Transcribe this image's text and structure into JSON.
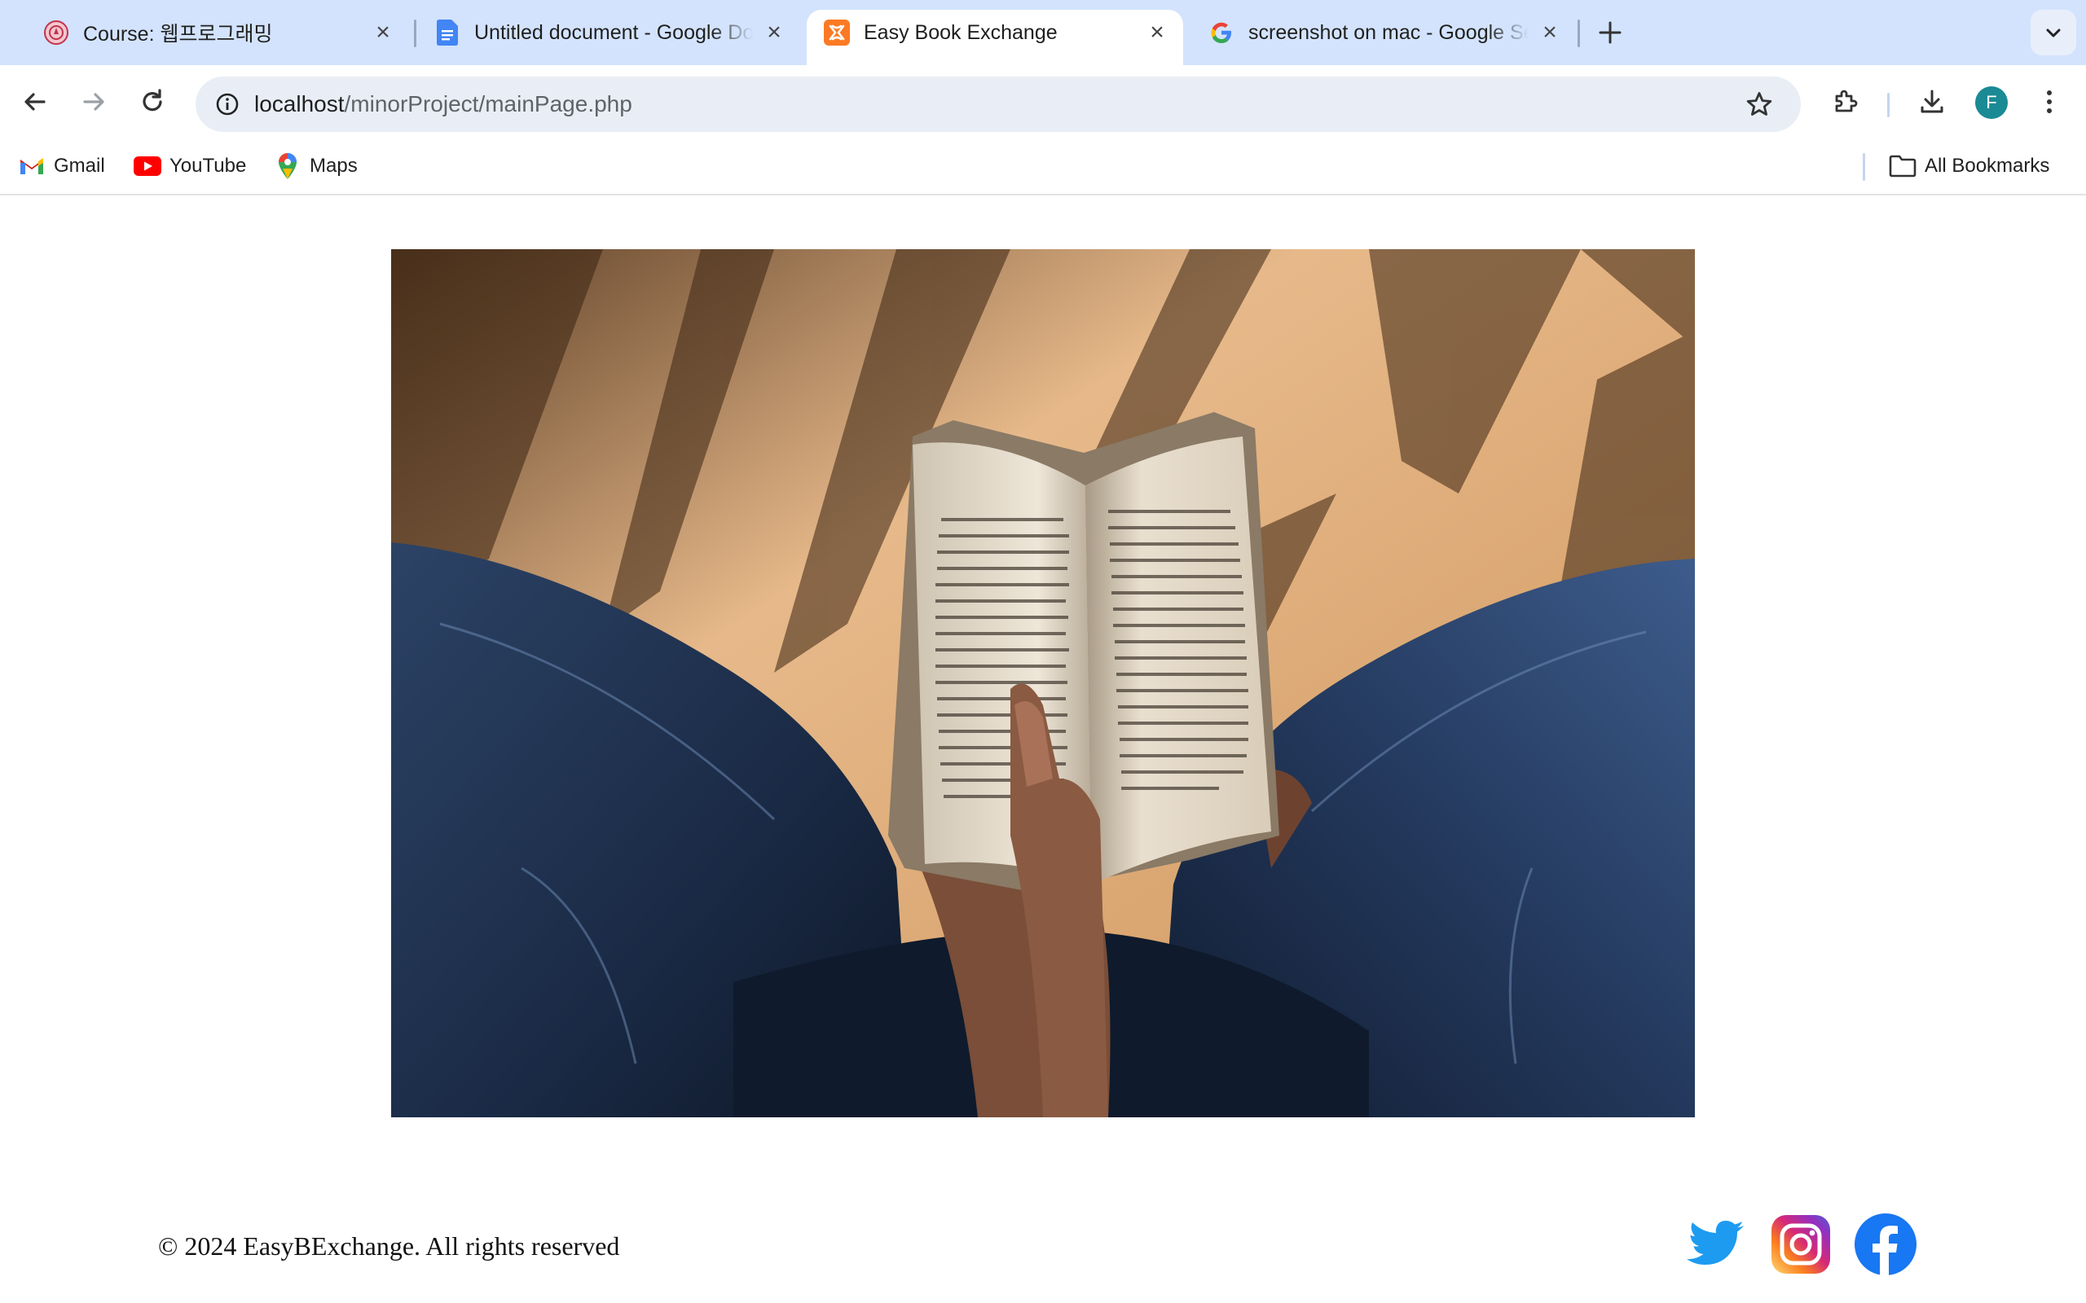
{
  "tabs": [
    {
      "title": "Course: 웹프로그래밍",
      "icon": "course-crest-icon"
    },
    {
      "title": "Untitled document - Google Docs",
      "icon": "google-docs-icon"
    },
    {
      "title": "Easy Book Exchange",
      "icon": "xampp-icon",
      "active": true
    },
    {
      "title": "screenshot on mac - Google Search",
      "icon": "google-g-icon"
    }
  ],
  "toolbar": {
    "url_host": "localhost",
    "url_path": "/minorProject/mainPage.php",
    "profile_initial": "F"
  },
  "bookmarks": {
    "items": [
      {
        "label": "Gmail",
        "icon": "gmail-icon"
      },
      {
        "label": "YouTube",
        "icon": "youtube-icon"
      },
      {
        "label": "Maps",
        "icon": "maps-pin-icon"
      }
    ],
    "all_bookmarks": "All Bookmarks"
  },
  "page": {
    "footer_text": "© 2024 EasyBExchange. All rights reserved",
    "social": [
      "twitter-icon",
      "instagram-icon",
      "facebook-icon"
    ]
  }
}
